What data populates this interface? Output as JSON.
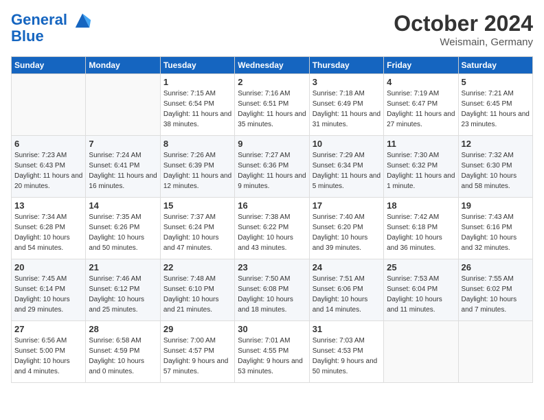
{
  "header": {
    "logo_line1": "General",
    "logo_line2": "Blue",
    "month": "October 2024",
    "location": "Weismain, Germany"
  },
  "weekdays": [
    "Sunday",
    "Monday",
    "Tuesday",
    "Wednesday",
    "Thursday",
    "Friday",
    "Saturday"
  ],
  "weeks": [
    [
      {
        "day": "",
        "sunrise": "",
        "sunset": "",
        "daylight": ""
      },
      {
        "day": "",
        "sunrise": "",
        "sunset": "",
        "daylight": ""
      },
      {
        "day": "1",
        "sunrise": "Sunrise: 7:15 AM",
        "sunset": "Sunset: 6:54 PM",
        "daylight": "Daylight: 11 hours and 38 minutes."
      },
      {
        "day": "2",
        "sunrise": "Sunrise: 7:16 AM",
        "sunset": "Sunset: 6:51 PM",
        "daylight": "Daylight: 11 hours and 35 minutes."
      },
      {
        "day": "3",
        "sunrise": "Sunrise: 7:18 AM",
        "sunset": "Sunset: 6:49 PM",
        "daylight": "Daylight: 11 hours and 31 minutes."
      },
      {
        "day": "4",
        "sunrise": "Sunrise: 7:19 AM",
        "sunset": "Sunset: 6:47 PM",
        "daylight": "Daylight: 11 hours and 27 minutes."
      },
      {
        "day": "5",
        "sunrise": "Sunrise: 7:21 AM",
        "sunset": "Sunset: 6:45 PM",
        "daylight": "Daylight: 11 hours and 23 minutes."
      }
    ],
    [
      {
        "day": "6",
        "sunrise": "Sunrise: 7:23 AM",
        "sunset": "Sunset: 6:43 PM",
        "daylight": "Daylight: 11 hours and 20 minutes."
      },
      {
        "day": "7",
        "sunrise": "Sunrise: 7:24 AM",
        "sunset": "Sunset: 6:41 PM",
        "daylight": "Daylight: 11 hours and 16 minutes."
      },
      {
        "day": "8",
        "sunrise": "Sunrise: 7:26 AM",
        "sunset": "Sunset: 6:39 PM",
        "daylight": "Daylight: 11 hours and 12 minutes."
      },
      {
        "day": "9",
        "sunrise": "Sunrise: 7:27 AM",
        "sunset": "Sunset: 6:36 PM",
        "daylight": "Daylight: 11 hours and 9 minutes."
      },
      {
        "day": "10",
        "sunrise": "Sunrise: 7:29 AM",
        "sunset": "Sunset: 6:34 PM",
        "daylight": "Daylight: 11 hours and 5 minutes."
      },
      {
        "day": "11",
        "sunrise": "Sunrise: 7:30 AM",
        "sunset": "Sunset: 6:32 PM",
        "daylight": "Daylight: 11 hours and 1 minute."
      },
      {
        "day": "12",
        "sunrise": "Sunrise: 7:32 AM",
        "sunset": "Sunset: 6:30 PM",
        "daylight": "Daylight: 10 hours and 58 minutes."
      }
    ],
    [
      {
        "day": "13",
        "sunrise": "Sunrise: 7:34 AM",
        "sunset": "Sunset: 6:28 PM",
        "daylight": "Daylight: 10 hours and 54 minutes."
      },
      {
        "day": "14",
        "sunrise": "Sunrise: 7:35 AM",
        "sunset": "Sunset: 6:26 PM",
        "daylight": "Daylight: 10 hours and 50 minutes."
      },
      {
        "day": "15",
        "sunrise": "Sunrise: 7:37 AM",
        "sunset": "Sunset: 6:24 PM",
        "daylight": "Daylight: 10 hours and 47 minutes."
      },
      {
        "day": "16",
        "sunrise": "Sunrise: 7:38 AM",
        "sunset": "Sunset: 6:22 PM",
        "daylight": "Daylight: 10 hours and 43 minutes."
      },
      {
        "day": "17",
        "sunrise": "Sunrise: 7:40 AM",
        "sunset": "Sunset: 6:20 PM",
        "daylight": "Daylight: 10 hours and 39 minutes."
      },
      {
        "day": "18",
        "sunrise": "Sunrise: 7:42 AM",
        "sunset": "Sunset: 6:18 PM",
        "daylight": "Daylight: 10 hours and 36 minutes."
      },
      {
        "day": "19",
        "sunrise": "Sunrise: 7:43 AM",
        "sunset": "Sunset: 6:16 PM",
        "daylight": "Daylight: 10 hours and 32 minutes."
      }
    ],
    [
      {
        "day": "20",
        "sunrise": "Sunrise: 7:45 AM",
        "sunset": "Sunset: 6:14 PM",
        "daylight": "Daylight: 10 hours and 29 minutes."
      },
      {
        "day": "21",
        "sunrise": "Sunrise: 7:46 AM",
        "sunset": "Sunset: 6:12 PM",
        "daylight": "Daylight: 10 hours and 25 minutes."
      },
      {
        "day": "22",
        "sunrise": "Sunrise: 7:48 AM",
        "sunset": "Sunset: 6:10 PM",
        "daylight": "Daylight: 10 hours and 21 minutes."
      },
      {
        "day": "23",
        "sunrise": "Sunrise: 7:50 AM",
        "sunset": "Sunset: 6:08 PM",
        "daylight": "Daylight: 10 hours and 18 minutes."
      },
      {
        "day": "24",
        "sunrise": "Sunrise: 7:51 AM",
        "sunset": "Sunset: 6:06 PM",
        "daylight": "Daylight: 10 hours and 14 minutes."
      },
      {
        "day": "25",
        "sunrise": "Sunrise: 7:53 AM",
        "sunset": "Sunset: 6:04 PM",
        "daylight": "Daylight: 10 hours and 11 minutes."
      },
      {
        "day": "26",
        "sunrise": "Sunrise: 7:55 AM",
        "sunset": "Sunset: 6:02 PM",
        "daylight": "Daylight: 10 hours and 7 minutes."
      }
    ],
    [
      {
        "day": "27",
        "sunrise": "Sunrise: 6:56 AM",
        "sunset": "Sunset: 5:00 PM",
        "daylight": "Daylight: 10 hours and 4 minutes."
      },
      {
        "day": "28",
        "sunrise": "Sunrise: 6:58 AM",
        "sunset": "Sunset: 4:59 PM",
        "daylight": "Daylight: 10 hours and 0 minutes."
      },
      {
        "day": "29",
        "sunrise": "Sunrise: 7:00 AM",
        "sunset": "Sunset: 4:57 PM",
        "daylight": "Daylight: 9 hours and 57 minutes."
      },
      {
        "day": "30",
        "sunrise": "Sunrise: 7:01 AM",
        "sunset": "Sunset: 4:55 PM",
        "daylight": "Daylight: 9 hours and 53 minutes."
      },
      {
        "day": "31",
        "sunrise": "Sunrise: 7:03 AM",
        "sunset": "Sunset: 4:53 PM",
        "daylight": "Daylight: 9 hours and 50 minutes."
      },
      {
        "day": "",
        "sunrise": "",
        "sunset": "",
        "daylight": ""
      },
      {
        "day": "",
        "sunrise": "",
        "sunset": "",
        "daylight": ""
      }
    ]
  ]
}
